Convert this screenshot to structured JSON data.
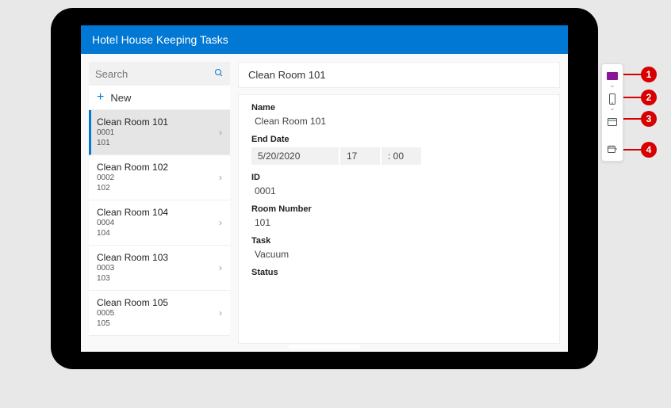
{
  "header": {
    "title": "Hotel House Keeping Tasks"
  },
  "search": {
    "placeholder": "Search"
  },
  "newButton": {
    "label": "New"
  },
  "list": {
    "items": [
      {
        "title": "Clean Room 101",
        "id": "0001",
        "room": "101",
        "selected": true
      },
      {
        "title": "Clean Room 102",
        "id": "0002",
        "room": "102",
        "selected": false
      },
      {
        "title": "Clean Room 104",
        "id": "0004",
        "room": "104",
        "selected": false
      },
      {
        "title": "Clean Room 103",
        "id": "0003",
        "room": "103",
        "selected": false
      },
      {
        "title": "Clean Room 105",
        "id": "0005",
        "room": "105",
        "selected": false
      }
    ]
  },
  "detail": {
    "headerTitle": "Clean Room 101",
    "fields": {
      "nameLabel": "Name",
      "nameValue": "Clean Room 101",
      "endDateLabel": "End Date",
      "endDateDate": "5/20/2020",
      "endDateHour": "17",
      "endDateMin": ": 00",
      "idLabel": "ID",
      "idValue": "0001",
      "roomLabel": "Room Number",
      "roomValue": "101",
      "taskLabel": "Task",
      "taskValue": "Vacuum",
      "statusLabel": "Status"
    }
  },
  "callouts": [
    "1",
    "2",
    "3",
    "4"
  ]
}
